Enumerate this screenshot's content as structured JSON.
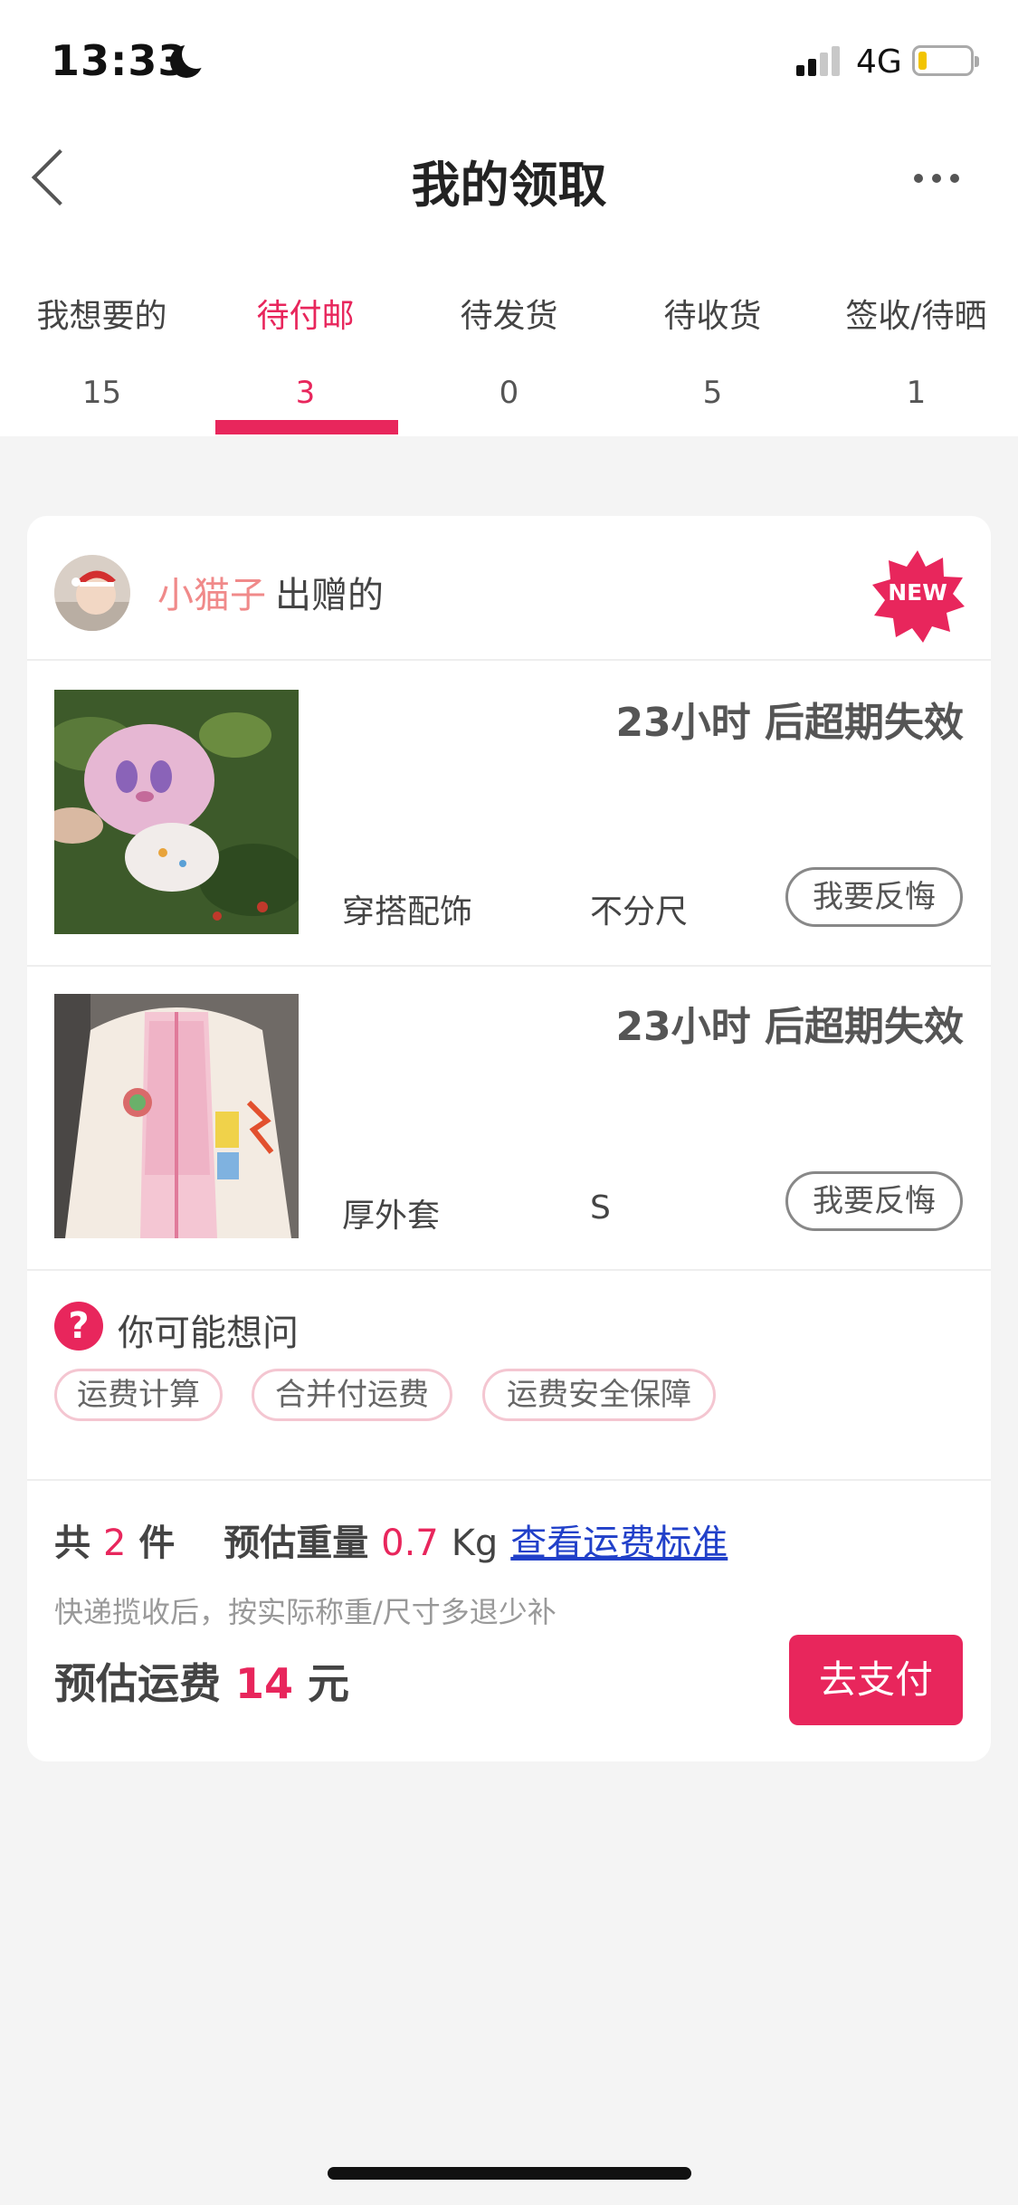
{
  "status_bar": {
    "time": "13:33",
    "network": "4G"
  },
  "nav": {
    "title": "我的领取"
  },
  "tabs": [
    {
      "label": "我想要的",
      "count": "15"
    },
    {
      "label": "待付邮",
      "count": "3",
      "active": true
    },
    {
      "label": "待发货",
      "count": "0"
    },
    {
      "label": "待收货",
      "count": "5"
    },
    {
      "label": "签收/待晒",
      "count": "1"
    }
  ],
  "card": {
    "giver_name": "小猫子",
    "giver_suffix": "出赠的",
    "badge": "NEW",
    "items": [
      {
        "expiry": "23小时 后超期失效",
        "category": "穿搭配饰",
        "size": "不分尺",
        "action": "我要反悔"
      },
      {
        "expiry": "23小时 后超期失效",
        "category": "厚外套",
        "size": "S",
        "action": "我要反悔"
      }
    ],
    "faq": {
      "title": "你可能想问",
      "chips": [
        "运费计算",
        "合并付运费",
        "运费安全保障"
      ]
    },
    "summary": {
      "total_prefix": "共",
      "total_count": "2",
      "total_unit": "件",
      "weight_label": "预估重量",
      "weight_value": "0.7",
      "weight_unit": "Kg",
      "standard_link": "查看运费标准",
      "note": "快递揽收后，按实际称重/尺寸多退少补",
      "fee_label": "预估运费",
      "fee_value": "14",
      "fee_unit": "元"
    },
    "pay_button": "去支付"
  },
  "colors": {
    "accent": "#e8265c",
    "link": "#2140c9",
    "giver_name": "#f08a8a"
  }
}
